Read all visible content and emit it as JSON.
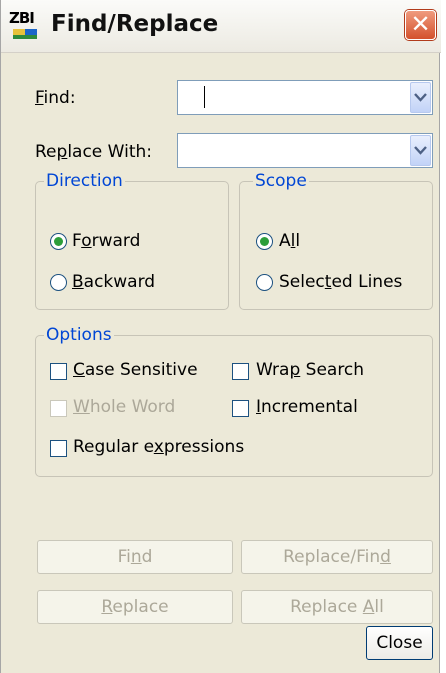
{
  "window": {
    "title": "Find/Replace",
    "icon_text": "ZBI",
    "icon": "zbi-app-icon",
    "close_icon": "close-x-icon"
  },
  "find": {
    "label": "Find:",
    "mnemonic": "F",
    "value": ""
  },
  "replace_with": {
    "label": "Replace With:",
    "mnemonic": "p",
    "value": ""
  },
  "direction": {
    "legend": "Direction",
    "options": [
      {
        "label": "Forward",
        "mnemonic": "o",
        "selected": true
      },
      {
        "label": "Backward",
        "mnemonic": "B",
        "selected": false
      }
    ]
  },
  "scope": {
    "legend": "Scope",
    "options": [
      {
        "label": "All",
        "mnemonic": "l",
        "selected": true
      },
      {
        "label": "Selected Lines",
        "mnemonic": "t",
        "selected": false
      }
    ]
  },
  "options": {
    "legend": "Options",
    "items": [
      {
        "label": "Case Sensitive",
        "mnemonic": "C",
        "checked": false,
        "enabled": true
      },
      {
        "label": "Wrap Search",
        "mnemonic": "p",
        "checked": false,
        "enabled": true
      },
      {
        "label": "Whole Word",
        "mnemonic": "W",
        "checked": false,
        "enabled": false
      },
      {
        "label": "Incremental",
        "mnemonic": "I",
        "checked": false,
        "enabled": true
      },
      {
        "label": "Regular expressions",
        "mnemonic": "x",
        "checked": false,
        "enabled": true
      }
    ]
  },
  "buttons": {
    "find": {
      "label": "Find",
      "mnemonic": "n",
      "enabled": false
    },
    "replace_find": {
      "label": "Replace/Find",
      "mnemonic": "d",
      "enabled": false
    },
    "replace": {
      "label": "Replace",
      "mnemonic": "R",
      "enabled": false
    },
    "replace_all": {
      "label": "Replace All",
      "mnemonic": "A",
      "enabled": false
    },
    "close": {
      "label": "Close",
      "enabled": true
    }
  },
  "colors": {
    "legend_text": "#0046d5",
    "radio_selected": "#2d9e3a",
    "disabled_text": "#aca899",
    "title_close_button": "#d4512d"
  }
}
